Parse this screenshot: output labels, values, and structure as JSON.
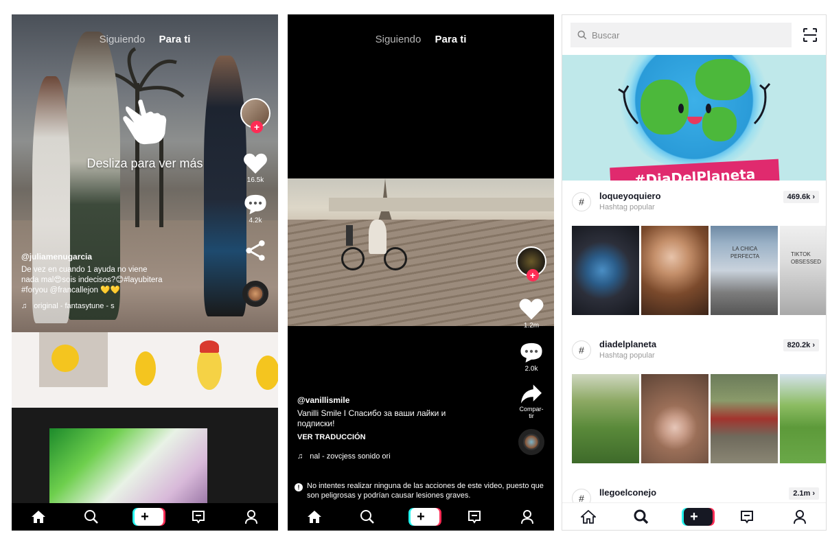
{
  "screen1": {
    "tabs": {
      "following": "Siguiendo",
      "for_you": "Para ti"
    },
    "swipe_hint": "Desliza para ver más",
    "likes": "16.5k",
    "comments": "4.2k",
    "username": "@juliamenugarcia",
    "caption_line1": "De vez en cuando 1 ayuda no viene",
    "caption_line2": "nada mal😍sois indecisos?😊#layubitera",
    "caption_line3": "#foryou @francallejon 💛💛",
    "music": "original - fantasytune - s"
  },
  "screen2": {
    "tabs": {
      "following": "Siguiendo",
      "for_you": "Para ti"
    },
    "likes": "1.2m",
    "comments": "2.0k",
    "share_label": "Compar-tir",
    "username": "@vanillismile",
    "caption_line1": "Vanilli Smile I Спасибо за ваши лайки и",
    "caption_line2": "подписки!",
    "translate": "VER TRADUCCIÓN",
    "music": "nal - zovcjess   sonido ori",
    "warning": "No intentes realizar ninguna de las acciones de este video, puesto que son peligrosas y podrían causar lesiones graves."
  },
  "screen3": {
    "search_placeholder": "Buscar",
    "banner_text": "#DiaDelPlaneta",
    "hashtags": [
      {
        "name": "loqueyoquiero",
        "sub": "Hashtag popular",
        "count": "469.6k ›"
      },
      {
        "name": "diadelplaneta",
        "sub": "Hashtag popular",
        "count": "820.2k ›"
      },
      {
        "name": "llegoelconejo",
        "sub": "",
        "count": "2.1m ›"
      }
    ],
    "thumb_texts": [
      "LA CHICA PERFECTA",
      "TIKTOK OBSESSED"
    ]
  },
  "colors": {
    "accent": "#fe2c55",
    "cyan": "#25f4ee",
    "ribbon": "#e02a6e"
  }
}
